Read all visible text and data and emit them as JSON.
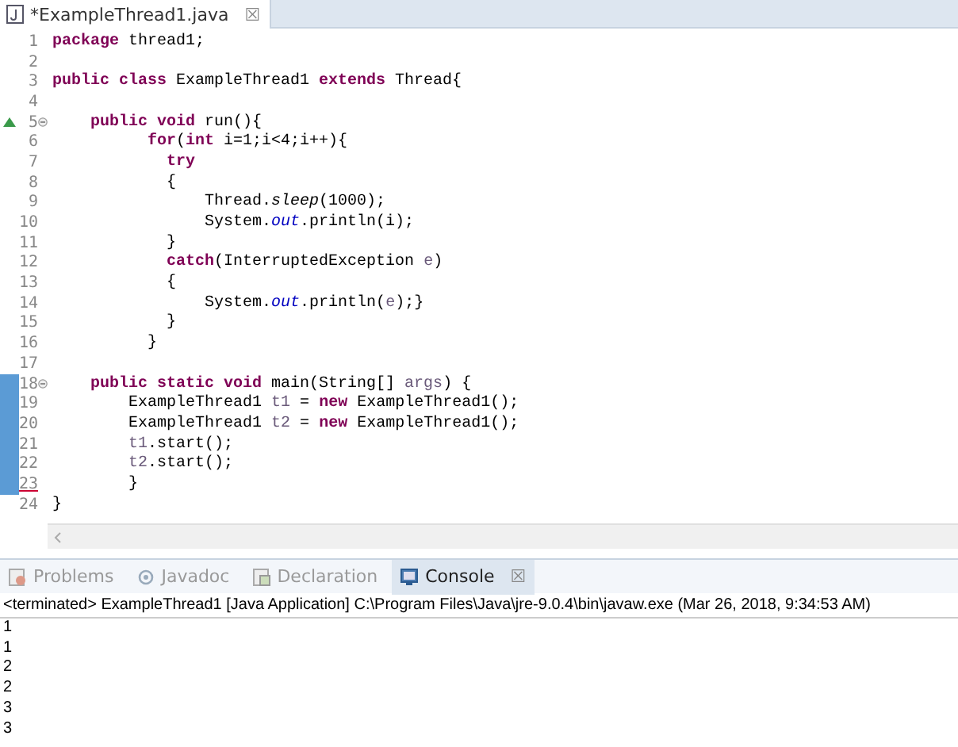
{
  "editor": {
    "tab": {
      "title": "*ExampleThread1.java",
      "close": "☒"
    },
    "lines": [
      {
        "number": "1",
        "tokens": [
          {
            "kind": "kw",
            "text": "package"
          },
          {
            "kind": "plain",
            "text": " thread1;"
          }
        ]
      },
      {
        "number": "2"
      },
      {
        "number": "3",
        "tokens": [
          {
            "kind": "kw",
            "text": "public class"
          },
          {
            "kind": "plain",
            "text": " ExampleThread1 "
          },
          {
            "kind": "kw",
            "text": "extends"
          },
          {
            "kind": "plain",
            "text": " Thread{"
          }
        ]
      },
      {
        "number": "4"
      },
      {
        "number": "5",
        "override": true,
        "fold": true,
        "tokens": [
          {
            "kind": "kw",
            "text": "    public void"
          },
          {
            "kind": "plain",
            "text": " run(){"
          }
        ]
      },
      {
        "number": "6",
        "tokens": [
          {
            "kind": "kw",
            "text": "          for"
          },
          {
            "kind": "plain",
            "text": "("
          },
          {
            "kind": "kw",
            "text": "int"
          },
          {
            "kind": "plain",
            "text": " i=1;i<4;i++){"
          }
        ]
      },
      {
        "number": "7",
        "tokens": [
          {
            "kind": "kw",
            "text": "            try"
          }
        ]
      },
      {
        "number": "8",
        "tokens": [
          {
            "kind": "plain",
            "text": "            {"
          }
        ]
      },
      {
        "number": "9",
        "tokens": [
          {
            "kind": "plain",
            "text": "                Thread."
          },
          {
            "kind": "static",
            "text": "sleep"
          },
          {
            "kind": "plain",
            "text": "(1000);"
          }
        ]
      },
      {
        "number": "10",
        "tokens": [
          {
            "kind": "plain",
            "text": "                System."
          },
          {
            "kind": "field",
            "text": "out"
          },
          {
            "kind": "plain",
            "text": ".println(i);"
          }
        ]
      },
      {
        "number": "11",
        "tokens": [
          {
            "kind": "plain",
            "text": "            }"
          }
        ]
      },
      {
        "number": "12",
        "tokens": [
          {
            "kind": "kw",
            "text": "            catch"
          },
          {
            "kind": "plain",
            "text": "(InterruptedException "
          },
          {
            "kind": "param",
            "text": "e"
          },
          {
            "kind": "plain",
            "text": ")"
          }
        ]
      },
      {
        "number": "13",
        "tokens": [
          {
            "kind": "plain",
            "text": "            {"
          }
        ]
      },
      {
        "number": "14",
        "tokens": [
          {
            "kind": "plain",
            "text": "                System."
          },
          {
            "kind": "field",
            "text": "out"
          },
          {
            "kind": "plain",
            "text": ".println("
          },
          {
            "kind": "param",
            "text": "e"
          },
          {
            "kind": "plain",
            "text": ");}"
          }
        ]
      },
      {
        "number": "15",
        "tokens": [
          {
            "kind": "plain",
            "text": "            }"
          }
        ]
      },
      {
        "number": "16",
        "tokens": [
          {
            "kind": "plain",
            "text": "          }"
          }
        ]
      },
      {
        "number": "17"
      },
      {
        "number": "18",
        "fold": true,
        "changed": true,
        "tokens": [
          {
            "kind": "kw",
            "text": "    public static void"
          },
          {
            "kind": "plain",
            "text": " main(String[] "
          },
          {
            "kind": "param",
            "text": "args"
          },
          {
            "kind": "plain",
            "text": ") {"
          }
        ]
      },
      {
        "number": "19",
        "changed": true,
        "tokens": [
          {
            "kind": "plain",
            "text": "        ExampleThread1 "
          },
          {
            "kind": "param",
            "text": "t1"
          },
          {
            "kind": "plain",
            "text": " = "
          },
          {
            "kind": "kw",
            "text": "new"
          },
          {
            "kind": "plain",
            "text": " ExampleThread1();"
          }
        ]
      },
      {
        "number": "20",
        "changed": true,
        "tokens": [
          {
            "kind": "plain",
            "text": "        ExampleThread1 "
          },
          {
            "kind": "param",
            "text": "t2"
          },
          {
            "kind": "plain",
            "text": " = "
          },
          {
            "kind": "kw",
            "text": "new"
          },
          {
            "kind": "plain",
            "text": " ExampleThread1();"
          }
        ]
      },
      {
        "number": "21",
        "changed": true,
        "tokens": [
          {
            "kind": "param",
            "text": "        t1"
          },
          {
            "kind": "plain",
            "text": ".start();"
          }
        ]
      },
      {
        "number": "22",
        "changed": true,
        "tokens": [
          {
            "kind": "param",
            "text": "        t2"
          },
          {
            "kind": "plain",
            "text": ".start();"
          }
        ]
      },
      {
        "number": "23",
        "changed": true,
        "current": true,
        "tokens": [
          {
            "kind": "plain",
            "text": "        }"
          }
        ]
      },
      {
        "number": "24",
        "tokens": [
          {
            "kind": "plain",
            "text": "}"
          }
        ]
      }
    ]
  },
  "panel": {
    "tabs": [
      {
        "kind": "problems",
        "label": "Problems",
        "selected": false
      },
      {
        "kind": "javadoc",
        "label": "Javadoc",
        "selected": false
      },
      {
        "kind": "declaration",
        "label": "Declaration",
        "selected": false
      },
      {
        "kind": "console",
        "label": "Console",
        "selected": true,
        "close": "☒"
      }
    ],
    "console": {
      "header": "<terminated> ExampleThread1 [Java Application] C:\\Program Files\\Java\\jre-9.0.4\\bin\\javaw.exe (Mar 26, 2018, 9:34:53 AM)",
      "output": [
        "1",
        "1",
        "2",
        "2",
        "3",
        "3"
      ]
    }
  }
}
